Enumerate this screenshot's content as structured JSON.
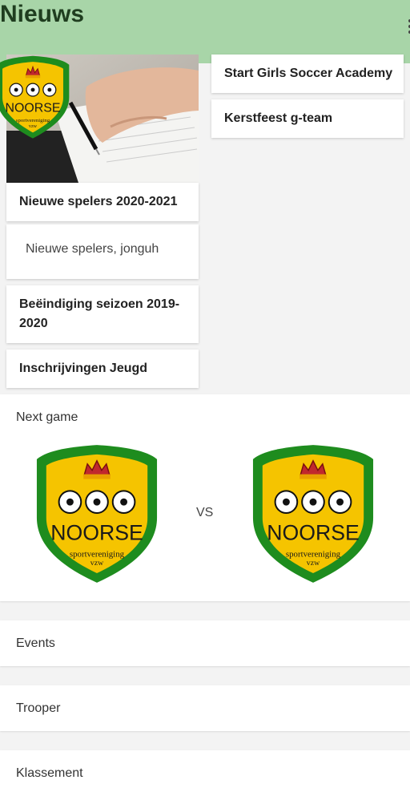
{
  "header": {
    "title": "Nieuws"
  },
  "news": {
    "left": [
      {
        "title": "Nieuwe spelers 2020-2021",
        "excerpt": "Nieuwe spelers, jonguh"
      },
      {
        "title": "Beëindiging seizoen 2019-2020"
      },
      {
        "title": "Inschrijvingen Jeugd"
      }
    ],
    "right": [
      {
        "title": "Start Girls Soccer Academy"
      },
      {
        "title": "Kerstfeest g-team"
      }
    ]
  },
  "logo": {
    "name": "NOORSE",
    "sub1": "sportvereniging",
    "sub2": "vzw"
  },
  "next_game": {
    "label": "Next game",
    "vs": "VS"
  },
  "sections": {
    "events": "Events",
    "trooper": "Trooper",
    "klassement": "Klassement"
  },
  "colors": {
    "header": "#a8d5a8",
    "shield_green": "#1e8c1e",
    "shield_yellow": "#f5c400",
    "crown_red": "#c0282d"
  }
}
